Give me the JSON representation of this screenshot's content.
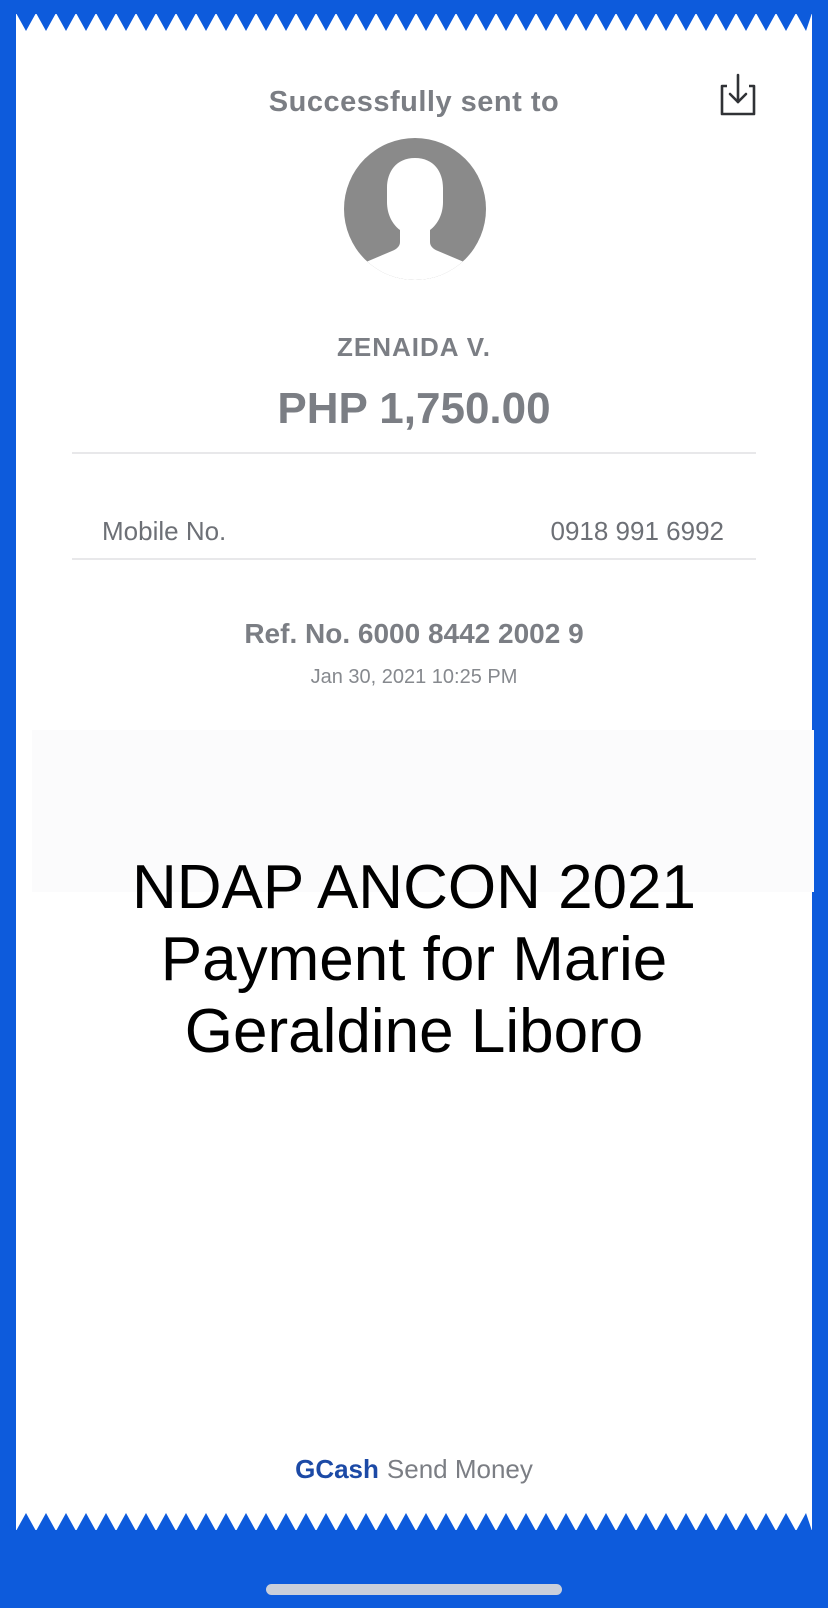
{
  "receipt": {
    "header_title": "Successfully sent to",
    "recipient_name": "ZENAIDA V.",
    "amount": "PHP 1,750.00",
    "mobile_label": "Mobile No.",
    "mobile_value": "0918 991 6992",
    "reference": "Ref. No. 6000 8442 2002 9",
    "datetime": "Jan 30, 2021 10:25 PM",
    "note_lines": [
      "NDAP ANCON 2021",
      "Payment for Marie",
      "Geraldine Liboro"
    ],
    "footer_brand": "GCash",
    "footer_service": "Send Money"
  },
  "icons": {
    "download": "download-icon",
    "avatar": "user-avatar-icon"
  },
  "colors": {
    "background": "#0d5bdc",
    "brand": "#1c4aa6",
    "text_gray": "#7b7e84"
  }
}
